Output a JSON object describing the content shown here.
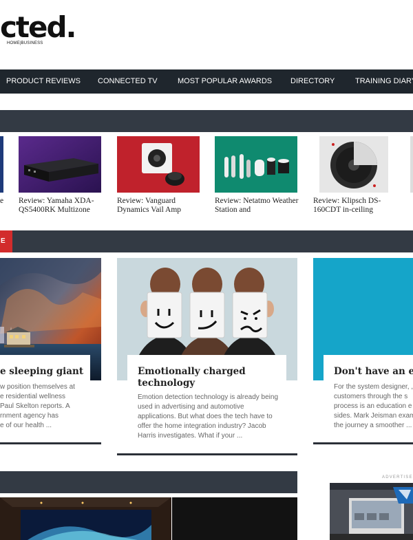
{
  "logo": {
    "text": "cted.",
    "subtext": "HOME|BUSINESS"
  },
  "nav": [
    {
      "label": "PRODUCT REVIEWS"
    },
    {
      "label": "CONNECTED TV"
    },
    {
      "label": "MOST POPULAR AWARDS"
    },
    {
      "label": "DIRECTORY"
    },
    {
      "label": "TRAINING DIARY"
    }
  ],
  "products": [
    {
      "title": "Review: Yamaha XDA-QS5400RK Multizone"
    },
    {
      "title": "Review: Vanguard Dynamics Vail Amp"
    },
    {
      "title": "Review: Netatmo Weather Station and"
    },
    {
      "title": "Review: Klipsch DS-160CDT in-ceiling"
    }
  ],
  "partial_product_text": "e",
  "section_tag": "E",
  "features": [
    {
      "title": "e sleeping giant",
      "text": "w position themselves at\ne residential wellness\nPaul Skelton reports. A\nrnment agency has\ne of our health ..."
    },
    {
      "title": "Emotionally charged technology",
      "text": "Emotion detection technology is already being used in advertising and automotive applications. But what does the tech have to offer the home integration industry? Jacob Harris investigates. What if your ..."
    },
    {
      "title": "Don't have an eage",
      "text": "For the system designer, ,\ncustomers through the s\nprocess is an education e\nsides. Mark Jeisman exam\nthe journey a smoother ..."
    }
  ],
  "advertise_label": "ADVERTISE",
  "colors": {
    "nav_bg": "#1f262d",
    "section_bar": "#333a44",
    "accent_red": "#d22c2c"
  }
}
